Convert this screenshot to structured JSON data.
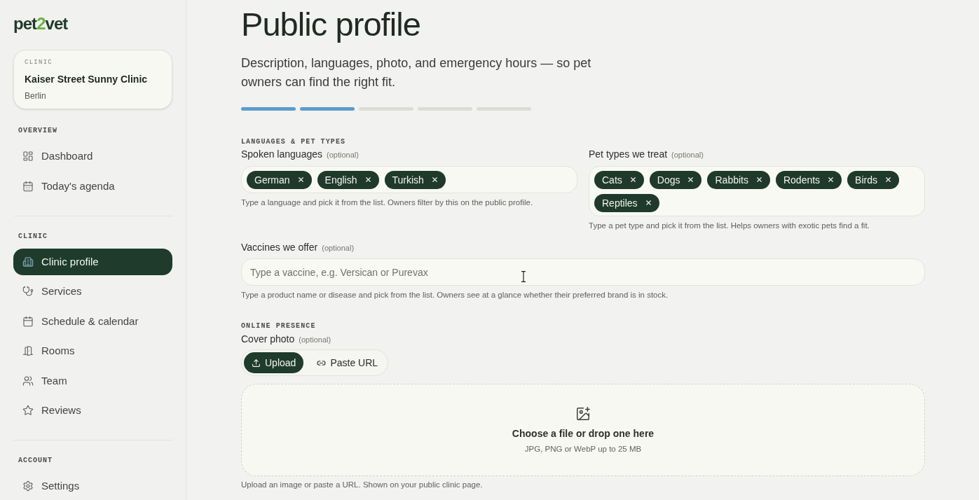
{
  "sidebar": {
    "logo": {
      "before": "pet",
      "accent": "2",
      "after": "vet"
    },
    "clinic_card": {
      "label": "CLINIC",
      "name": "Kaiser Street Sunny Clinic",
      "city": "Berlin"
    },
    "sections": [
      {
        "title": "OVERVIEW",
        "items": [
          {
            "label": "Dashboard",
            "selected": false
          },
          {
            "label": "Today's agenda",
            "selected": false
          }
        ]
      },
      {
        "title": "CLINIC",
        "items": [
          {
            "label": "Clinic profile",
            "selected": true
          },
          {
            "label": "Services",
            "selected": false
          },
          {
            "label": "Schedule & calendar",
            "selected": false
          },
          {
            "label": "Rooms",
            "selected": false
          },
          {
            "label": "Team",
            "selected": false
          },
          {
            "label": "Reviews",
            "selected": false
          }
        ]
      },
      {
        "title": "ACCOUNT",
        "items": [
          {
            "label": "Settings",
            "selected": false
          }
        ]
      }
    ]
  },
  "page": {
    "title": "Public profile",
    "subtitle": "Description, languages, photo, and emergency hours — so pet owners can find the right fit.",
    "steps": [
      {
        "complete": true
      },
      {
        "complete": true
      },
      {
        "complete": false
      },
      {
        "complete": false
      },
      {
        "complete": false
      }
    ]
  },
  "languages_section": {
    "heading": "LANGUAGES & PET TYPES",
    "spoken_languages": {
      "label": "Spoken languages",
      "optional": "(optional)",
      "chips": [
        "German",
        "English",
        "Turkish"
      ],
      "hint": "Type a language and pick it from the list. Owners filter by this on the public profile."
    },
    "pet_types": {
      "label": "Pet types we treat",
      "optional": "(optional)",
      "chips": [
        "Cats",
        "Dogs",
        "Rabbits",
        "Rodents",
        "Birds",
        "Reptiles"
      ],
      "hint": "Type a pet type and pick it from the list. Helps owners with exotic pets find a fit."
    }
  },
  "vaccines": {
    "label": "Vaccines we offer",
    "optional": "(optional)",
    "placeholder": "Type a vaccine, e.g. Versican or Purevax",
    "hint": "Type a product name or disease and pick from the list. Owners see at a glance whether their preferred brand is in stock."
  },
  "online_presence": {
    "heading": "ONLINE PRESENCE",
    "cover_photo": {
      "label": "Cover photo",
      "optional": "(optional)",
      "source_tabs": [
        {
          "label": "Upload",
          "selected": true
        },
        {
          "label": "Paste URL",
          "selected": false
        }
      ],
      "dropzone": {
        "title": "Choose a file or drop one here",
        "subtitle": "JPG, PNG or WebP up to 25 MB"
      },
      "hint": "Upload an image or paste a URL. Shown on your public clinic page."
    }
  }
}
